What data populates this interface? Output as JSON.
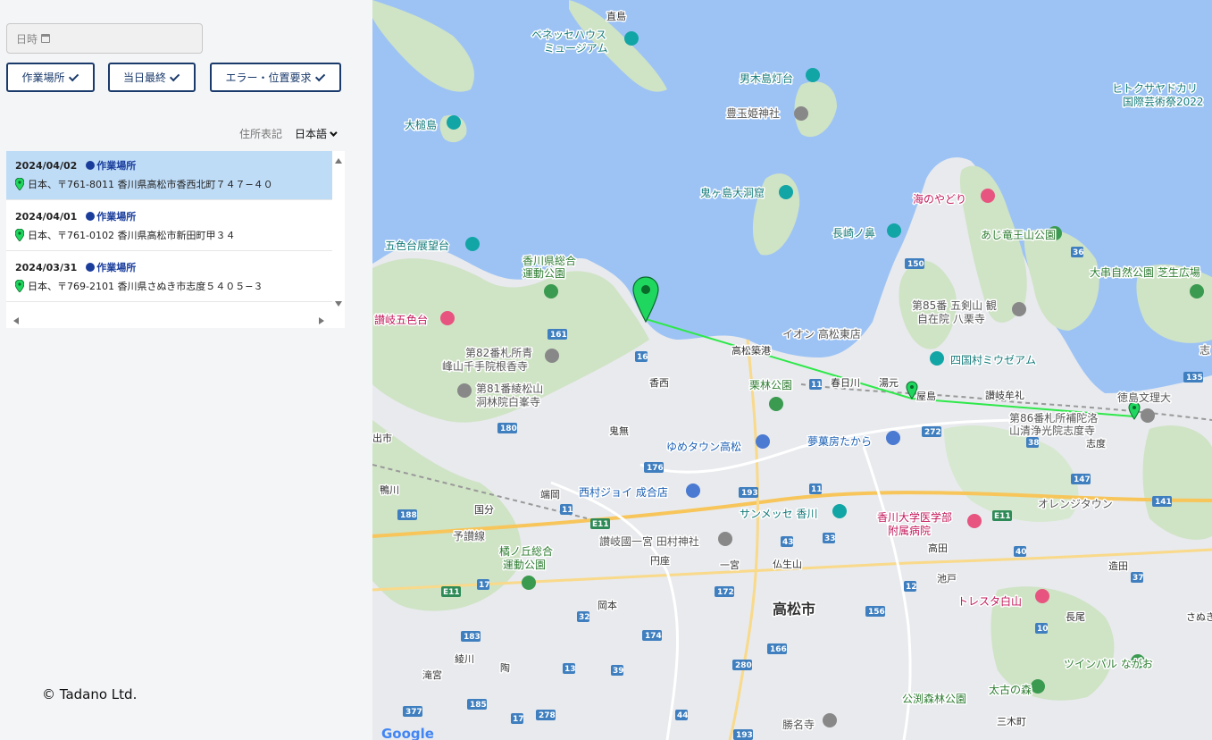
{
  "filters": {
    "date_placeholder": "日時",
    "buttons": [
      {
        "label": "作業場所"
      },
      {
        "label": "当日最終"
      },
      {
        "label": "エラー・位置要求"
      }
    ]
  },
  "address_notation": {
    "label": "住所表記",
    "selected": "日本語"
  },
  "records": [
    {
      "date": "2024/04/02",
      "type": "作業場所",
      "address": "日本、〒761-8011 香川県高松市香西北町７４７−４０",
      "selected": true
    },
    {
      "date": "2024/04/01",
      "type": "作業場所",
      "address": "日本、〒761-0102 香川県高松市新田町甲３４",
      "selected": false
    },
    {
      "date": "2024/03/31",
      "type": "作業場所",
      "address": "日本、〒769-2101 香川県さぬき市志度５４０５−３",
      "selected": false
    }
  ],
  "footer": {
    "copyright": "© Tadano Ltd."
  },
  "colors": {
    "accent": "#1a3a6b",
    "selected_row": "#bfdcf7",
    "marker": "#1fd65f",
    "route_line": "#2ee84a",
    "sea": "#9dc3f5",
    "land": "#e8eaed"
  },
  "map": {
    "labels": {
      "naoshima": "直島",
      "benesse": "ベネッセハウス",
      "benesse2": "ミュージアム",
      "ogijima_lighthouse": "男木島灯台",
      "toyotamahime": "豊玉姫神社",
      "hitokusa": "ヒトクサヤドカリ",
      "hitokusa2": "国際芸術祭2022",
      "otsuchi": "大槌島",
      "onigashima": "鬼ヶ島大洞窟",
      "uminoyadori": "海のやどり",
      "nagasakinohana": "長崎ノ鼻",
      "ajiryuo": "あじ竜王山公園",
      "goshikidai_view": "五色台展望台",
      "kagawa_park1": "香川県総合",
      "kagawa_park2": "運動公園",
      "okushi": "大串自然公園 芝生広場",
      "sanuki_goshikidai": "讃岐五色台",
      "no85": "第85番 五剣山 観",
      "no85b": "自在院 八栗寺",
      "aeon": "イオン 高松東店",
      "takamatsu_port": "高松築港",
      "shikokumura": "四国村ミウゼアム",
      "no82": "第82番札所青",
      "no82b": "峰山千手院根香寺",
      "kozai": "香西",
      "ritsurin": "栗林公園",
      "kasugagawa": "春日川",
      "yumoto": "湯元",
      "yashima": "屋島",
      "sanukimure": "讃岐牟礼",
      "tokushima_bunri": "徳島文理大",
      "no81": "第81番綾松山",
      "no81b": "洞林院白峯寺",
      "no86": "第86番札所補陀洛",
      "no86b": "山清浄光院志度寺",
      "shido": "志度",
      "kinashi": "鬼無",
      "youme": "ゆめタウン高松",
      "yumesabo": "夢菓房たから",
      "demachi": "出市",
      "hashioka": "端岡",
      "nishimura": "西村ジョイ 成合店",
      "kamogawa": "鴨川",
      "kokubu": "国分",
      "sunmesse": "サンメッセ 香川",
      "kagawa_univ1": "香川大学医学部",
      "kagawa_univ2": "附属病院",
      "orange": "オレンジタウン",
      "tachibana1": "橘ノ丘総合",
      "tachibana2": "運動公園",
      "sanuki_ichinomiya": "讃岐國一宮 田村神社",
      "yosan": "予讃線",
      "takada": "高田",
      "enza": "円座",
      "ichinomiya": "一宮",
      "busshozan": "仏生山",
      "ikenobe": "池戸",
      "zoda": "造田",
      "okamoto": "岡本",
      "takamatsu_city": "高松市",
      "tresta": "トレスタ白山",
      "nagao": "長尾",
      "sanuki_right": "さぬき",
      "ayagawa": "綾川",
      "takinomiya": "滝宮",
      "sue": "陶",
      "twinpal": "ツインパル ながお",
      "taikonomori": "太古の森",
      "kobuchi": "公渕森林公園",
      "katsumyoji": "勝名寺",
      "miki": "三木町",
      "shi": "志",
      "google": "Google"
    },
    "routes": [
      "161",
      "16",
      "11",
      "150",
      "36",
      "135",
      "180",
      "272",
      "38",
      "176",
      "193",
      "11",
      "147",
      "141",
      "188",
      "11",
      "E11",
      "43",
      "33",
      "12",
      "37",
      "40",
      "10",
      "17",
      "172",
      "156",
      "183",
      "32",
      "174",
      "166",
      "13",
      "39",
      "185",
      "17",
      "278",
      "44",
      "193",
      "377",
      "280",
      "E11",
      "E11"
    ]
  }
}
